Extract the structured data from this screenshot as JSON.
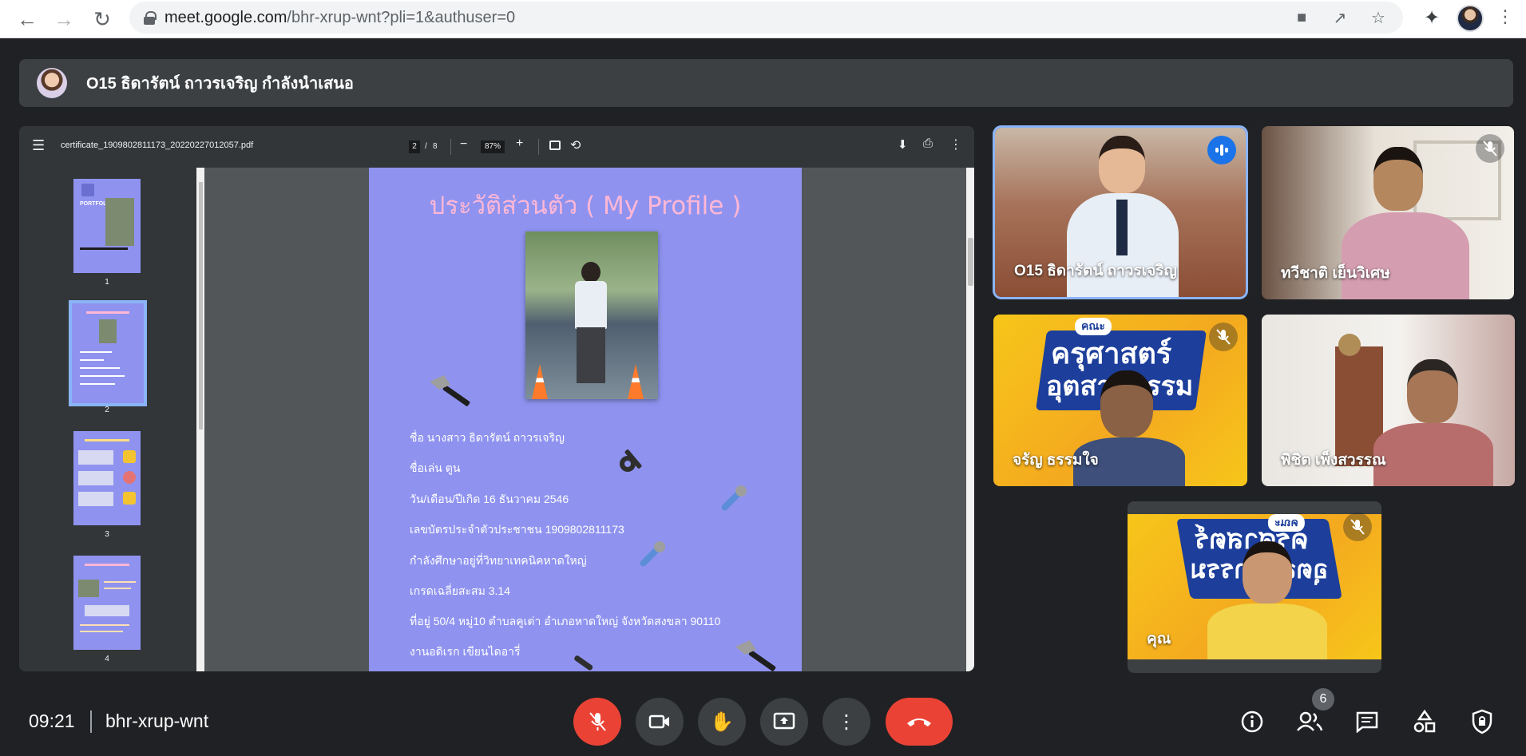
{
  "browser": {
    "url_host": "meet.google.com",
    "url_path": "/bhr-xrup-wnt?pli=1&authuser=0"
  },
  "presenter": {
    "banner_text": "O15 ธิดารัตน์ ถาวรเจริญ กำลังนำเสนอ"
  },
  "pdf": {
    "filename": "certificate_1909802811173_20220227012057.pdf",
    "current_page": "2",
    "page_separator": "/",
    "total_pages": "8",
    "zoom": "87%",
    "thumbnails": [
      "1",
      "2",
      "3",
      "4"
    ],
    "thumb_cover_text": "PORTFOLIO",
    "page": {
      "heading": "ประวัติส่วนตัว ( My Profile )",
      "lines": [
        "ชื่อ นางสาว ธิดารัตน์ ถาวรเจริญ",
        "ชื่อเล่น ตูน",
        "วัน/เดือน/ปีเกิด 16 ธันวาคม 2546",
        "เลขบัตรประจำตัวประชาชน 1909802811173",
        "กำลังศึกษาอยู่ที่วิทยาเทคนิคหาดใหญ่",
        "เกรดเฉลี่ยสะสม 3.14",
        "ที่อยู่ 50/4 หมู่10 ตำบลคูเต่า อำเภอหาดใหญ่ จังหวัดสงขลา 90110",
        "งานอดิเรก เขียนไดอารี่"
      ]
    }
  },
  "participants": [
    {
      "name": "O15 ธิดารัตน์ ถาวรเจริญ",
      "mic": "speaking"
    },
    {
      "name": "ทวีชาติ เย็นวิเศษ",
      "mic": "muted"
    },
    {
      "name": "จรัญ ธรรมใจ",
      "mic": "muted",
      "banner_line1": "ครุศาสตร์",
      "banner_line2": "อุตสาหกรรม",
      "banner_tag": "คณะ"
    },
    {
      "name": "พิชิต เพ็งสวรรณ",
      "mic": "none"
    },
    {
      "name": "คุณ",
      "mic": "muted",
      "banner_line1": "ครุศาสตร์",
      "banner_line2": "อุตสาหกรรม",
      "banner_tag": "คณะ"
    }
  ],
  "meeting": {
    "time": "09:21",
    "code": "bhr-xrup-wnt",
    "people_count": "6"
  },
  "colors": {
    "meet_bg": "#202124",
    "accent_blue": "#8ab4f8",
    "danger_red": "#ea4335",
    "pdf_page": "#8f93ef"
  }
}
